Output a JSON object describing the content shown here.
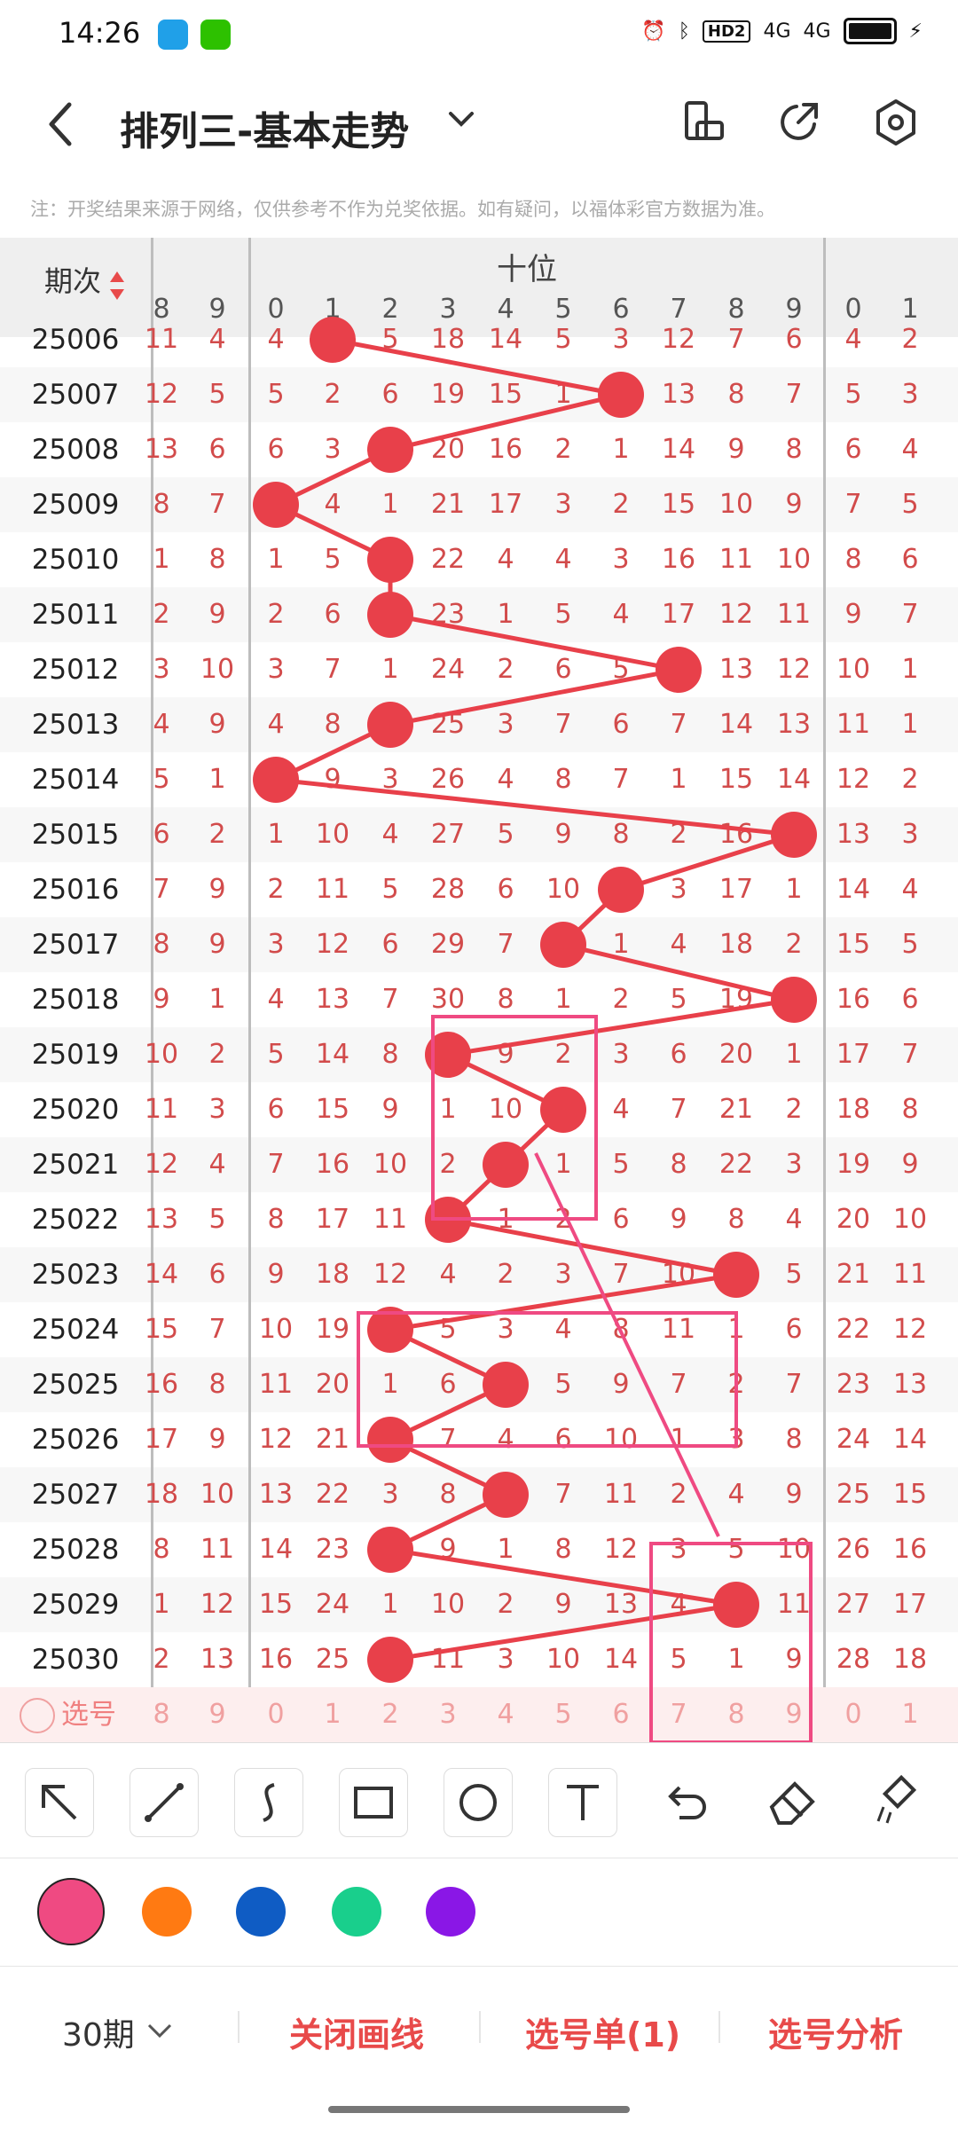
{
  "status": {
    "time": "14:26",
    "signal1": "4G",
    "signal2": "4G",
    "hd": "HD2"
  },
  "header": {
    "title": "排列三-基本走势"
  },
  "note": "注：开奖结果来源于网络，仅供参考不作为兑奖依据。如有疑问，以福体彩官方数据为准。",
  "table": {
    "period_header": "期次",
    "section_label": "十位",
    "left_digits": [
      "8",
      "9"
    ],
    "mid_digits": [
      "0",
      "1",
      "2",
      "3",
      "4",
      "5",
      "6",
      "7",
      "8",
      "9"
    ],
    "right_digits": [
      "0",
      "1"
    ],
    "rows": [
      {
        "p": "25006",
        "a": [
          "11",
          "4"
        ],
        "m": [
          "4",
          "1",
          "5",
          "18",
          "14",
          "5",
          "3",
          "12",
          "7",
          "6"
        ],
        "r": [
          "4",
          "2"
        ]
      },
      {
        "p": "25007",
        "a": [
          "12",
          "5"
        ],
        "m": [
          "5",
          "2",
          "6",
          "19",
          "15",
          "1",
          "6",
          "13",
          "8",
          "7"
        ],
        "r": [
          "5",
          "3"
        ]
      },
      {
        "p": "25008",
        "a": [
          "13",
          "6"
        ],
        "m": [
          "6",
          "3",
          "2",
          "20",
          "16",
          "2",
          "1",
          "14",
          "9",
          "8"
        ],
        "r": [
          "6",
          "4"
        ]
      },
      {
        "p": "25009",
        "a": [
          "8",
          "7"
        ],
        "m": [
          "0",
          "4",
          "1",
          "21",
          "17",
          "3",
          "2",
          "15",
          "10",
          "9"
        ],
        "r": [
          "7",
          "5"
        ]
      },
      {
        "p": "25010",
        "a": [
          "1",
          "8"
        ],
        "m": [
          "1",
          "5",
          "2",
          "22",
          "4",
          "4",
          "3",
          "16",
          "11",
          "10"
        ],
        "r": [
          "8",
          "6"
        ]
      },
      {
        "p": "25011",
        "a": [
          "2",
          "9"
        ],
        "m": [
          "2",
          "6",
          "2",
          "23",
          "1",
          "5",
          "4",
          "17",
          "12",
          "11"
        ],
        "r": [
          "9",
          "7"
        ]
      },
      {
        "p": "25012",
        "a": [
          "3",
          "10"
        ],
        "m": [
          "3",
          "7",
          "1",
          "24",
          "2",
          "6",
          "5",
          "7",
          "13",
          "12"
        ],
        "r": [
          "10",
          "1"
        ]
      },
      {
        "p": "25013",
        "a": [
          "4",
          "9"
        ],
        "m": [
          "4",
          "8",
          "2",
          "25",
          "3",
          "7",
          "6",
          "7",
          "14",
          "13"
        ],
        "r": [
          "11",
          "1"
        ]
      },
      {
        "p": "25014",
        "a": [
          "5",
          "1"
        ],
        "m": [
          "0",
          "9",
          "3",
          "26",
          "4",
          "8",
          "7",
          "1",
          "15",
          "14"
        ],
        "r": [
          "12",
          "2"
        ]
      },
      {
        "p": "25015",
        "a": [
          "6",
          "2"
        ],
        "m": [
          "1",
          "10",
          "4",
          "27",
          "5",
          "9",
          "8",
          "2",
          "16",
          "9"
        ],
        "r": [
          "13",
          "3"
        ]
      },
      {
        "p": "25016",
        "a": [
          "7",
          "9"
        ],
        "m": [
          "2",
          "11",
          "5",
          "28",
          "6",
          "10",
          "6",
          "3",
          "17",
          "1"
        ],
        "r": [
          "14",
          "4"
        ]
      },
      {
        "p": "25017",
        "a": [
          "8",
          "9"
        ],
        "m": [
          "3",
          "12",
          "6",
          "29",
          "7",
          "5",
          "1",
          "4",
          "18",
          "2"
        ],
        "r": [
          "15",
          "5"
        ]
      },
      {
        "p": "25018",
        "a": [
          "9",
          "1"
        ],
        "m": [
          "4",
          "13",
          "7",
          "30",
          "8",
          "1",
          "2",
          "5",
          "19",
          "9"
        ],
        "r": [
          "16",
          "6"
        ]
      },
      {
        "p": "25019",
        "a": [
          "10",
          "2"
        ],
        "m": [
          "5",
          "14",
          "8",
          "3",
          "9",
          "2",
          "3",
          "6",
          "20",
          "1"
        ],
        "r": [
          "17",
          "7"
        ]
      },
      {
        "p": "25020",
        "a": [
          "11",
          "3"
        ],
        "m": [
          "6",
          "15",
          "9",
          "1",
          "10",
          "5",
          "4",
          "7",
          "21",
          "2"
        ],
        "r": [
          "18",
          "8"
        ]
      },
      {
        "p": "25021",
        "a": [
          "12",
          "4"
        ],
        "m": [
          "7",
          "16",
          "10",
          "2",
          "4",
          "1",
          "5",
          "8",
          "22",
          "3"
        ],
        "r": [
          "19",
          "9"
        ]
      },
      {
        "p": "25022",
        "a": [
          "13",
          "5"
        ],
        "m": [
          "8",
          "17",
          "11",
          "3",
          "1",
          "2",
          "6",
          "9",
          "8",
          "4"
        ],
        "r": [
          "20",
          "10"
        ]
      },
      {
        "p": "25023",
        "a": [
          "14",
          "6"
        ],
        "m": [
          "9",
          "18",
          "12",
          "4",
          "2",
          "3",
          "7",
          "10",
          "8",
          "5"
        ],
        "r": [
          "21",
          "11"
        ]
      },
      {
        "p": "25024",
        "a": [
          "15",
          "7"
        ],
        "m": [
          "10",
          "19",
          "2",
          "5",
          "3",
          "4",
          "8",
          "11",
          "1",
          "6"
        ],
        "r": [
          "22",
          "12"
        ]
      },
      {
        "p": "25025",
        "a": [
          "16",
          "8"
        ],
        "m": [
          "11",
          "20",
          "1",
          "6",
          "4",
          "5",
          "9",
          "7",
          "2",
          "7"
        ],
        "r": [
          "23",
          "13"
        ]
      },
      {
        "p": "25026",
        "a": [
          "17",
          "9"
        ],
        "m": [
          "12",
          "21",
          "2",
          "7",
          "4",
          "6",
          "10",
          "1",
          "3",
          "8"
        ],
        "r": [
          "24",
          "14"
        ]
      },
      {
        "p": "25027",
        "a": [
          "18",
          "10"
        ],
        "m": [
          "13",
          "22",
          "3",
          "8",
          "4",
          "7",
          "11",
          "2",
          "4",
          "9"
        ],
        "r": [
          "25",
          "15"
        ]
      },
      {
        "p": "25028",
        "a": [
          "8",
          "11"
        ],
        "m": [
          "14",
          "23",
          "2",
          "9",
          "1",
          "8",
          "12",
          "3",
          "5",
          "10"
        ],
        "r": [
          "26",
          "16"
        ]
      },
      {
        "p": "25029",
        "a": [
          "1",
          "12"
        ],
        "m": [
          "15",
          "24",
          "1",
          "10",
          "2",
          "9",
          "13",
          "4",
          "8",
          "11"
        ],
        "r": [
          "27",
          "17"
        ]
      },
      {
        "p": "25030",
        "a": [
          "2",
          "13"
        ],
        "m": [
          "16",
          "25",
          "2",
          "11",
          "3",
          "10",
          "14",
          "5",
          "1",
          "9"
        ],
        "r": [
          "28",
          "18"
        ]
      }
    ],
    "select_label": "选号",
    "select_left": [
      "8",
      "9"
    ],
    "select_mid": [
      "0",
      "1",
      "2",
      "3",
      "4",
      "5",
      "6",
      "7",
      "8",
      "9"
    ],
    "select_right": [
      "0",
      "1"
    ]
  },
  "tools": [
    "arrow-tool",
    "line-tool",
    "curve-tool",
    "rect-tool",
    "circle-tool",
    "text-tool",
    "undo-tool",
    "eraser-tool",
    "clear-tool"
  ],
  "colors": [
    "#ef4a82",
    "#ff7a12",
    "#0f5cc4",
    "#19cf8c",
    "#8a17e6"
  ],
  "bottom": {
    "period": "30期",
    "close_lines": "关闭画线",
    "select_list": "选号单(1)",
    "analysis": "选号分析"
  }
}
